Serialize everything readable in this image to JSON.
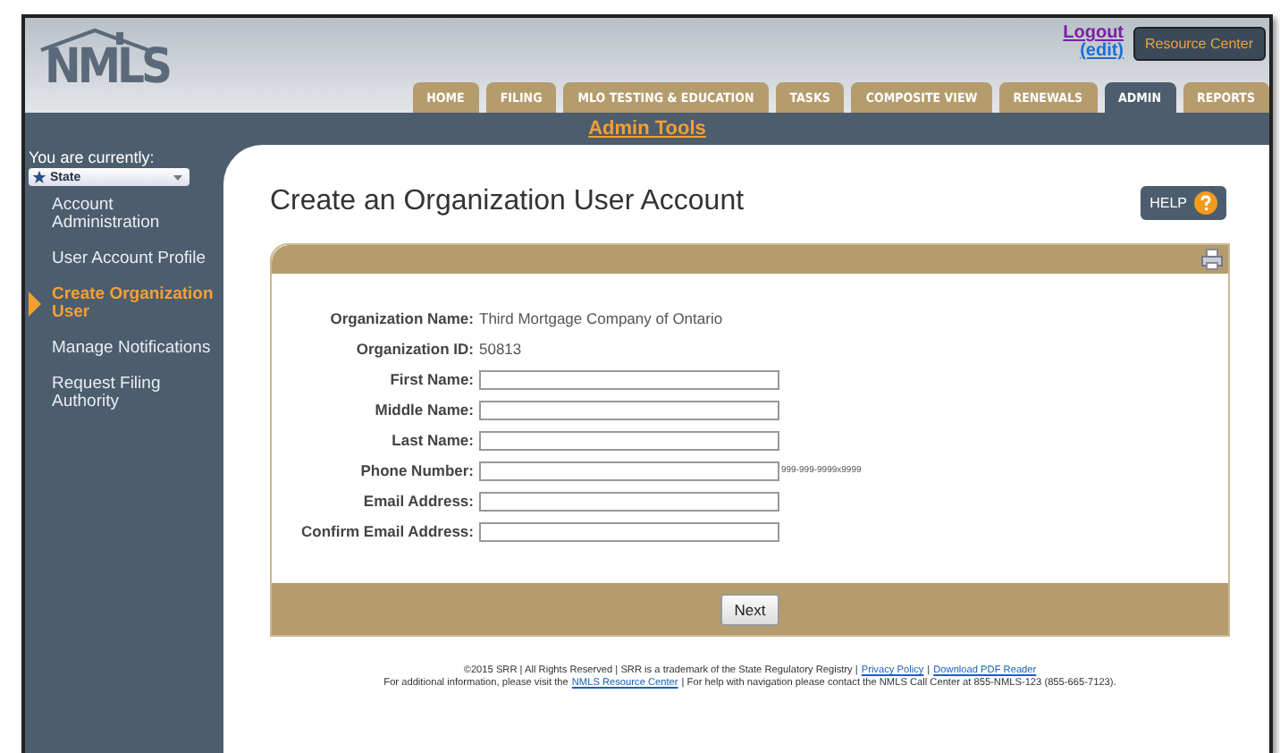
{
  "header": {
    "logo": "NMLS",
    "logout": "Logout",
    "edit": "(edit)",
    "resource_button": "Resource Center"
  },
  "tabs": [
    {
      "label": "HOME",
      "selected": false
    },
    {
      "label": "FILING",
      "selected": false
    },
    {
      "label": "MLO TESTING & EDUCATION",
      "selected": false
    },
    {
      "label": "TASKS",
      "selected": false
    },
    {
      "label": "COMPOSITE VIEW",
      "selected": false
    },
    {
      "label": "RENEWALS",
      "selected": false
    },
    {
      "label": "ADMIN",
      "selected": true
    },
    {
      "label": "REPORTS",
      "selected": false
    }
  ],
  "section_title": "Admin Tools",
  "sidebar": {
    "context_label": "You are currently:",
    "context_value": "State",
    "items": [
      {
        "label": "Account Administration",
        "selected": false
      },
      {
        "label": "User Account Profile",
        "selected": false
      },
      {
        "label": "Create Organization User",
        "selected": true
      },
      {
        "label": "Manage Notifications",
        "selected": false
      },
      {
        "label": "Request Filing Authority",
        "selected": false
      }
    ]
  },
  "page_title": "Create an Organization User Account",
  "help_button": "HELP",
  "form": {
    "fields": [
      {
        "kind": "info",
        "label": "Organization Name:",
        "value": "Third Mortgage Company of Ontario"
      },
      {
        "kind": "info",
        "label": "Organization ID:",
        "value": "50813"
      },
      {
        "kind": "input",
        "label": "First Name:"
      },
      {
        "kind": "input",
        "label": "Middle Name:"
      },
      {
        "kind": "input",
        "label": "Last Name:"
      },
      {
        "kind": "input",
        "label": "Phone Number:",
        "hint": "999-999-9999x9999"
      },
      {
        "kind": "input",
        "label": "Email Address:"
      },
      {
        "kind": "input",
        "label": "Confirm Email Address:"
      }
    ],
    "next_button": "Next"
  },
  "footer": {
    "lines": [
      [
        {
          "kind": "text",
          "text": "©2015 SRR | All Rights Reserved | SRR is a trademark of the State Regulatory Registry |"
        },
        {
          "kind": "link",
          "text": "Privacy Policy"
        },
        {
          "kind": "text",
          "text": "|"
        },
        {
          "kind": "link",
          "text": "Download PDF Reader"
        }
      ],
      [
        {
          "kind": "text",
          "text": "For additional information, please visit the"
        },
        {
          "kind": "link",
          "text": "NMLS Resource Center"
        },
        {
          "kind": "text",
          "text": "| For help with navigation please contact the NMLS Call Center at 855-NMLS-123 (855-665-7123)."
        }
      ]
    ]
  }
}
